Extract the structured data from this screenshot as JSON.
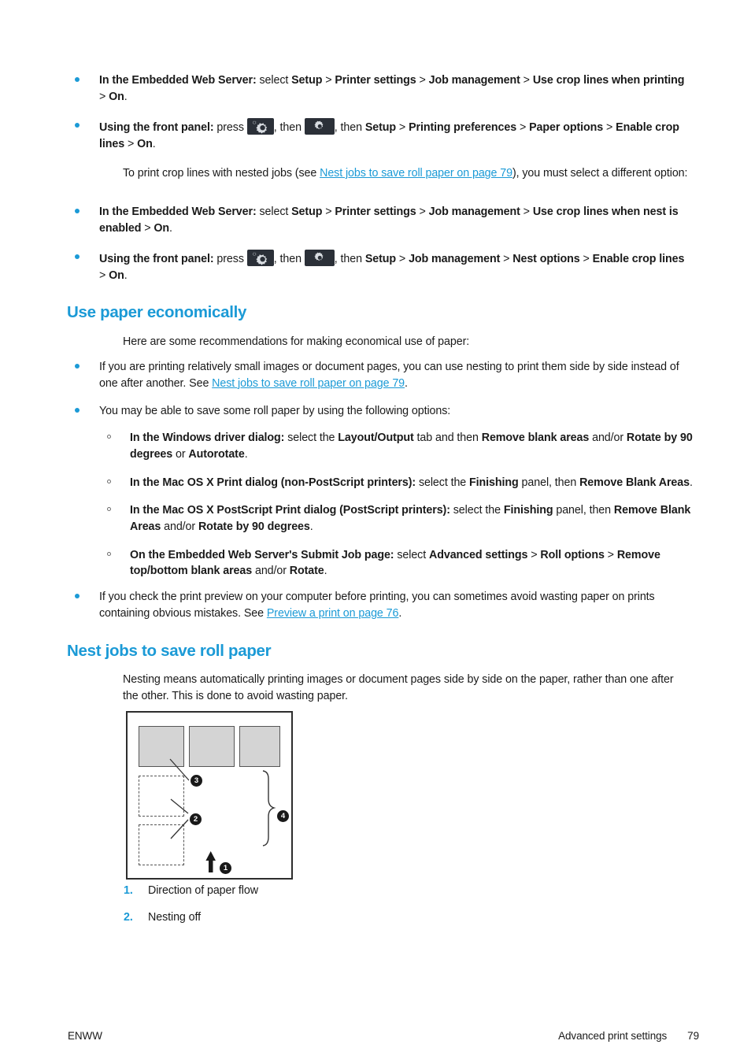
{
  "document": {
    "page_number": "79",
    "footer_left": "ENWW",
    "footer_section": "Advanced print settings"
  },
  "crop_lines": {
    "bullet1": {
      "lead": "In the Embedded Web Server:",
      "mid1": " select ",
      "b1": "Setup",
      "sep1": " > ",
      "b2": "Printer settings",
      "sep2": " > ",
      "b3": "Job management",
      "sep3": " > ",
      "b4": "Use crop lines when printing",
      "sep4": " > ",
      "b5": "On",
      "end": "."
    },
    "bullet2": {
      "lead": "Using the front panel:",
      "press": " press ",
      "then1": ", then ",
      "then2": ", then ",
      "b1": "Setup",
      "sep1": " > ",
      "b2": "Printing preferences",
      "sep2": " > ",
      "b3": "Paper options",
      "sep3": " > ",
      "b4": "Enable crop lines",
      "sep4": " > ",
      "b5": "On",
      "end": "."
    },
    "intro_nested_pre": "To print crop lines with nested jobs (see ",
    "intro_nested_link": "Nest jobs to save roll paper on page 79",
    "intro_nested_post": "), you must select a different option:",
    "bullet3": {
      "lead": "In the Embedded Web Server:",
      "mid1": " select ",
      "b1": "Setup",
      "sep1": " > ",
      "b2": "Printer settings",
      "sep2": " > ",
      "b3": "Job management",
      "sep3": " > ",
      "b4": "Use crop lines when nest is enabled",
      "sep4": " > ",
      "b5": "On",
      "end": "."
    },
    "bullet4": {
      "lead": "Using the front panel:",
      "press": " press ",
      "then1": ", then ",
      "then2": ", then ",
      "b1": "Setup",
      "sep1": " > ",
      "b2": "Job management",
      "sep2": " > ",
      "b3": "Nest options",
      "sep3": " > ",
      "b4": "Enable crop lines",
      "sep4": " > ",
      "b5": "On",
      "end": "."
    }
  },
  "use_paper": {
    "heading": "Use paper economically",
    "intro": "Here are some recommendations for making economical use of paper:",
    "b1_pre": "If you are printing relatively small images or document pages, you can use nesting to print them side by side instead of one after another. See ",
    "b1_link": "Nest jobs to save roll paper on page 79",
    "b1_post": ".",
    "b2": "You may be able to save some roll paper by using the following options:",
    "sub1": {
      "lead": "In the Windows driver dialog:",
      "t1": " select the ",
      "b1": "Layout/Output",
      "t2": " tab and then ",
      "b2": "Remove blank areas",
      "t3": " and/or ",
      "b3": "Rotate by 90 degrees",
      "t4": " or ",
      "b4": "Autorotate",
      "end": "."
    },
    "sub2": {
      "lead": "In the Mac OS X Print dialog (non-PostScript printers):",
      "t1": " select the ",
      "b1": "Finishing",
      "t2": " panel, then ",
      "b2": "Remove Blank Areas",
      "end": "."
    },
    "sub3": {
      "lead": "In the Mac OS X PostScript Print dialog (PostScript printers):",
      "t1": " select the ",
      "b1": "Finishing",
      "t2": " panel, then ",
      "b2": "Remove Blank Areas",
      "t3": " and/or ",
      "b3": "Rotate by 90 degrees",
      "end": "."
    },
    "sub4": {
      "lead": "On the Embedded Web Server's Submit Job page:",
      "t1": " select ",
      "b1": "Advanced settings",
      "t2": " > ",
      "b2": "Roll options",
      "t3": " > ",
      "b3": "Remove top/bottom blank areas",
      "t4": " and/or ",
      "b4": "Rotate",
      "end": "."
    },
    "b3_pre": "If you check the print preview on your computer before printing, you can sometimes avoid wasting paper on prints containing obvious mistakes. See ",
    "b3_link": "Preview a print on page 76",
    "b3_post": "."
  },
  "nest_jobs": {
    "heading": "Nest jobs to save roll paper",
    "intro": "Nesting means automatically printing images or document pages side by side on the paper, rather than one after the other. This is done to avoid wasting paper.",
    "figure": {
      "badges": [
        "1",
        "2",
        "3",
        "4"
      ]
    },
    "callouts": [
      {
        "num": "1.",
        "text": "Direction of paper flow"
      },
      {
        "num": "2.",
        "text": "Nesting off"
      }
    ]
  },
  "colors": {
    "accent_blue": "#1b9ad6",
    "text": "#1a1a1a",
    "key_background": "#2b3038",
    "swatch_fill": "#d4d4d4"
  }
}
